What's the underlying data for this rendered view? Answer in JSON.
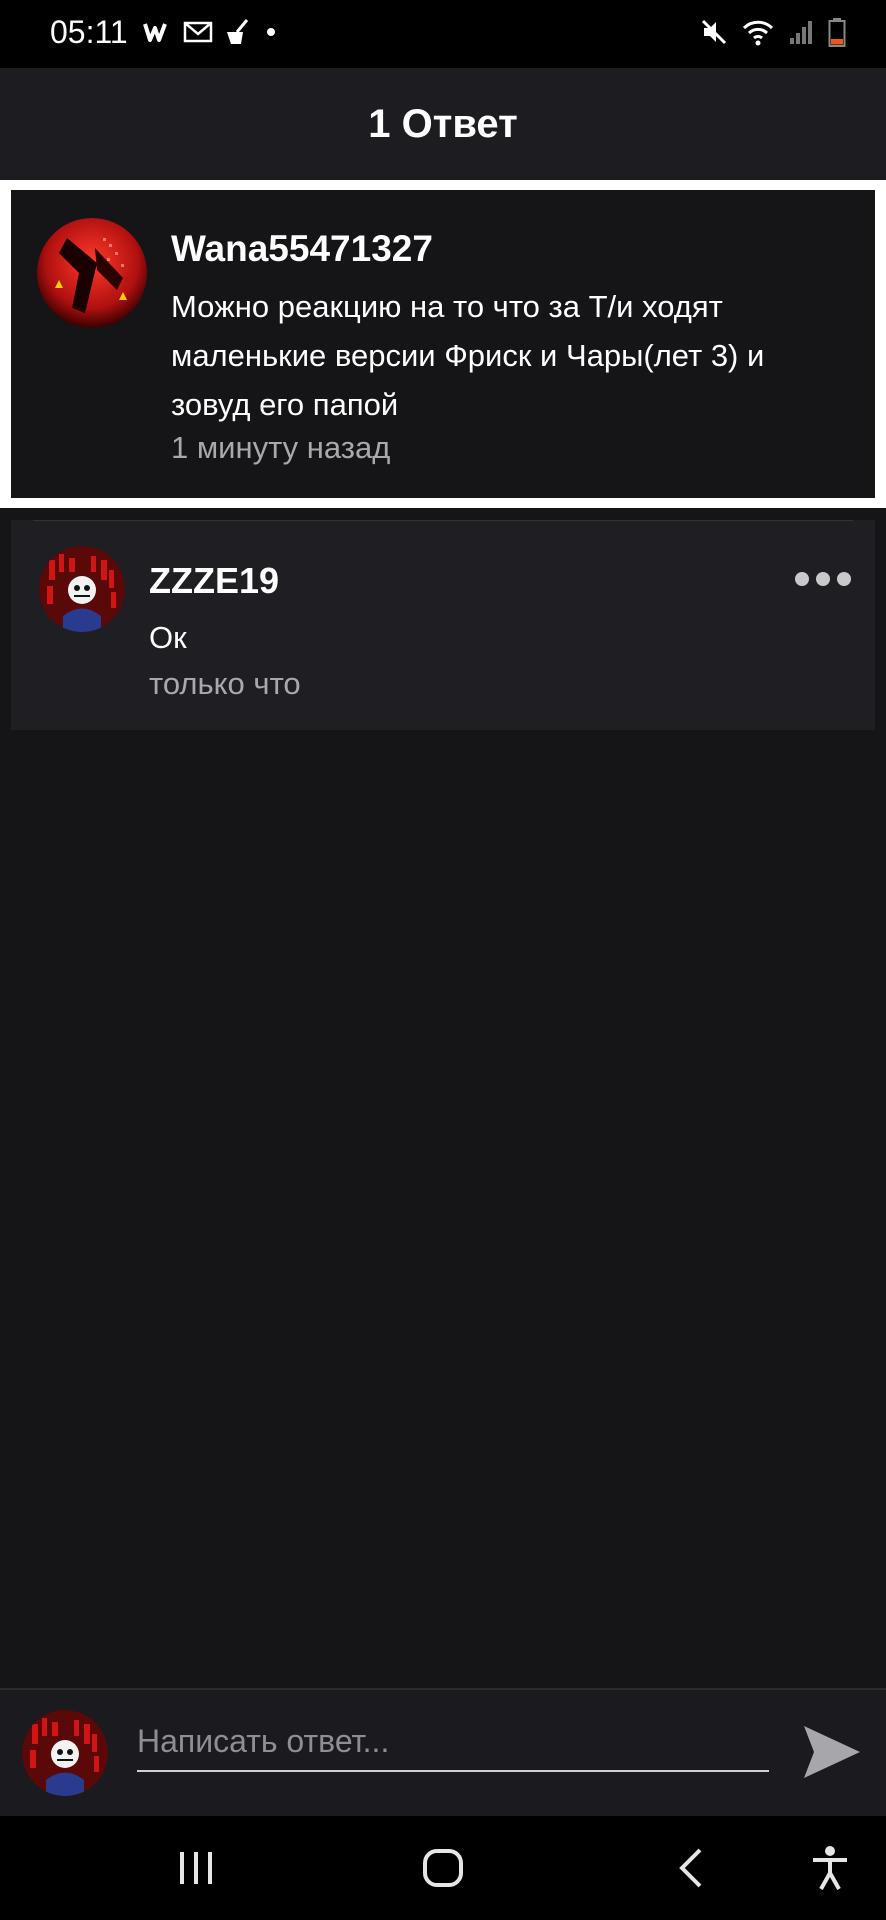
{
  "status_bar": {
    "time": "05:11",
    "app_icons": [
      "wattpad-icon",
      "gmail-icon",
      "cleaner-icon",
      "dot-icon"
    ],
    "right_icons": [
      "mute-icon",
      "wifi-icon",
      "signal-icon",
      "battery-icon"
    ]
  },
  "header": {
    "title": "1 Ответ"
  },
  "parent_comment": {
    "username": "Wana55471327",
    "text": "Можно реакцию на то что за Т/и ходят маленькие версии  Фриск и Чары(лет 3) и зовуд его папой",
    "time": "1 минуту назад"
  },
  "reply": {
    "username": "ZZZE19",
    "text": "Ок",
    "time": "только что",
    "more_icon": "more-horizontal-icon"
  },
  "composer": {
    "placeholder": "Написать ответ...",
    "value": "",
    "send_icon": "send-icon"
  },
  "nav_bar": {
    "buttons": [
      "recents-icon",
      "home-icon",
      "back-icon",
      "accessibility-icon"
    ]
  },
  "colors": {
    "background": "#151417",
    "header": "#1d1c20",
    "reply_card": "#1f1e22",
    "muted_text": "#a8a8ad",
    "avatar_red": "#b01010"
  }
}
